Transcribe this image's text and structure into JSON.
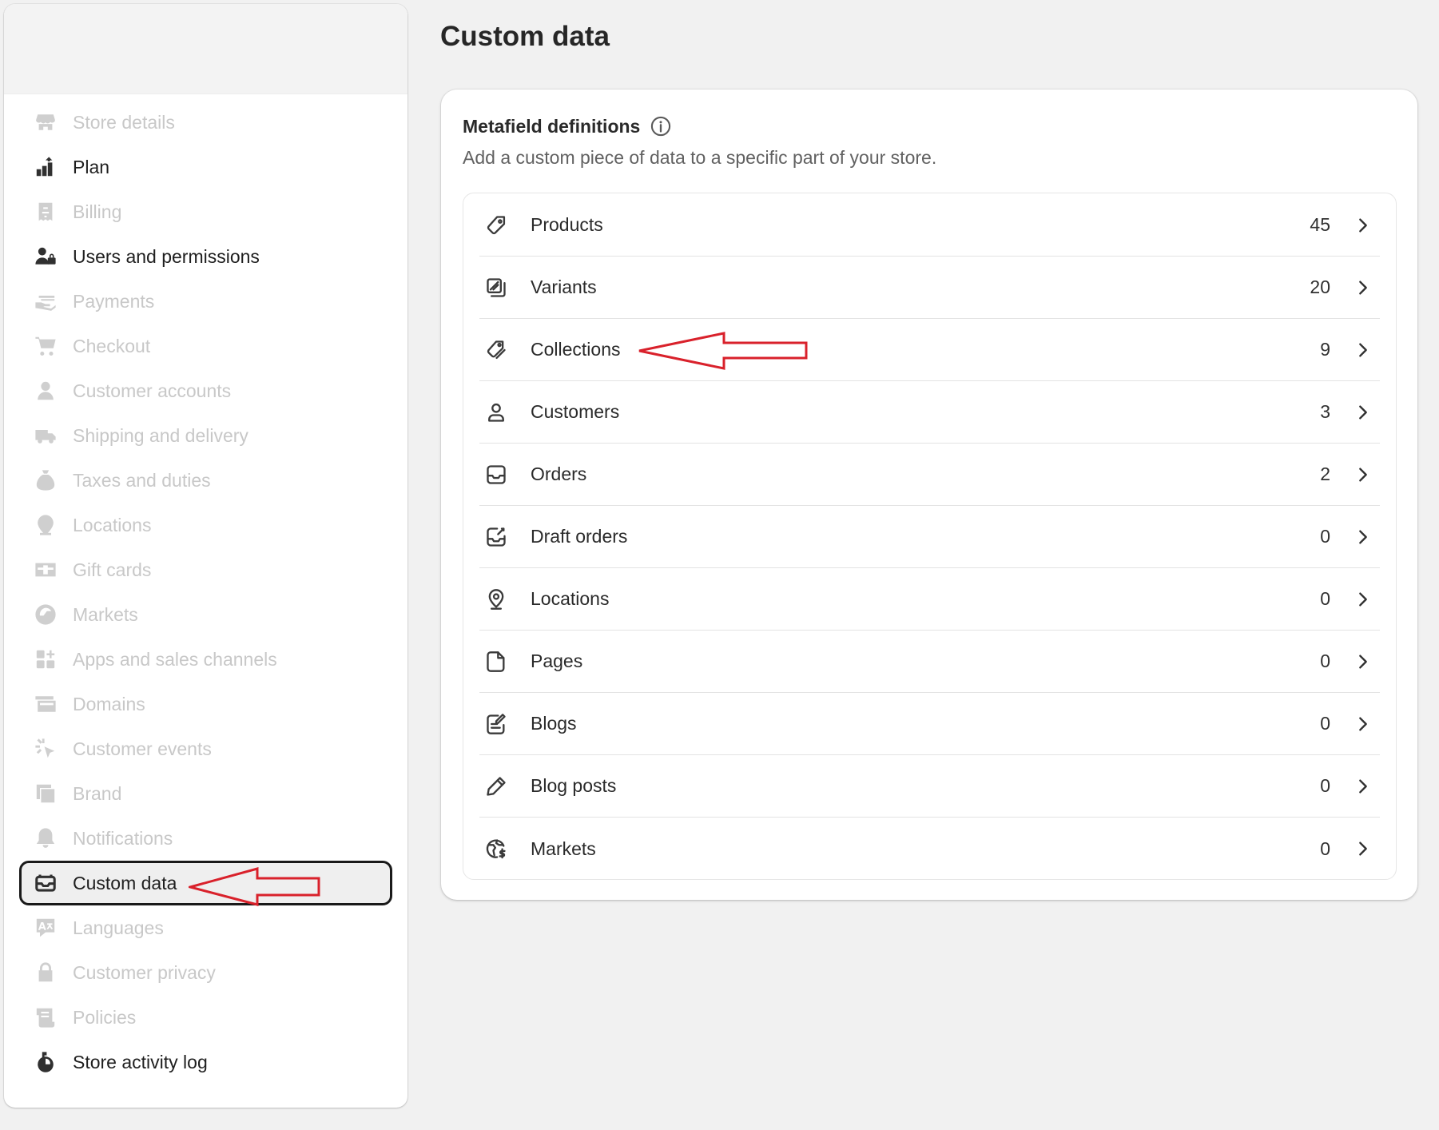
{
  "sidebar": {
    "items": [
      {
        "label": "Store details",
        "icon": "store-icon",
        "state": "disabled"
      },
      {
        "label": "Plan",
        "icon": "plan-icon",
        "state": "enabled"
      },
      {
        "label": "Billing",
        "icon": "receipt-icon",
        "state": "disabled"
      },
      {
        "label": "Users and permissions",
        "icon": "users-icon",
        "state": "enabled"
      },
      {
        "label": "Payments",
        "icon": "payment-hand-icon",
        "state": "disabled"
      },
      {
        "label": "Checkout",
        "icon": "cart-icon",
        "state": "disabled"
      },
      {
        "label": "Customer accounts",
        "icon": "person-icon",
        "state": "disabled"
      },
      {
        "label": "Shipping and delivery",
        "icon": "truck-icon",
        "state": "disabled"
      },
      {
        "label": "Taxes and duties",
        "icon": "tax-bag-icon",
        "state": "disabled"
      },
      {
        "label": "Locations",
        "icon": "location-pin-icon",
        "state": "disabled"
      },
      {
        "label": "Gift cards",
        "icon": "gift-card-icon",
        "state": "disabled"
      },
      {
        "label": "Markets",
        "icon": "globe-icon",
        "state": "disabled"
      },
      {
        "label": "Apps and sales channels",
        "icon": "apps-icon",
        "state": "disabled"
      },
      {
        "label": "Domains",
        "icon": "domains-icon",
        "state": "disabled"
      },
      {
        "label": "Customer events",
        "icon": "cursor-click-icon",
        "state": "disabled"
      },
      {
        "label": "Brand",
        "icon": "brand-icon",
        "state": "disabled"
      },
      {
        "label": "Notifications",
        "icon": "bell-icon",
        "state": "disabled"
      },
      {
        "label": "Custom data",
        "icon": "custom-data-icon",
        "state": "selected"
      },
      {
        "label": "Languages",
        "icon": "translate-icon",
        "state": "disabled"
      },
      {
        "label": "Customer privacy",
        "icon": "lock-icon",
        "state": "disabled"
      },
      {
        "label": "Policies",
        "icon": "policy-scroll-icon",
        "state": "disabled"
      },
      {
        "label": "Store activity log",
        "icon": "activity-log-icon",
        "state": "enabled"
      }
    ]
  },
  "main": {
    "title": "Custom data",
    "card": {
      "title": "Metafield definitions",
      "subtitle": "Add a custom piece of data to a specific part of your store.",
      "rows": [
        {
          "label": "Products",
          "count": "45",
          "icon": "tag-icon"
        },
        {
          "label": "Variants",
          "count": "20",
          "icon": "variants-icon"
        },
        {
          "label": "Collections",
          "count": "9",
          "icon": "collection-tag-icon"
        },
        {
          "label": "Customers",
          "count": "3",
          "icon": "person-outline-icon"
        },
        {
          "label": "Orders",
          "count": "2",
          "icon": "inbox-icon"
        },
        {
          "label": "Draft orders",
          "count": "0",
          "icon": "draft-order-icon"
        },
        {
          "label": "Locations",
          "count": "0",
          "icon": "location-outline-icon"
        },
        {
          "label": "Pages",
          "count": "0",
          "icon": "page-icon"
        },
        {
          "label": "Blogs",
          "count": "0",
          "icon": "blog-icon"
        },
        {
          "label": "Blog posts",
          "count": "0",
          "icon": "pencil-icon"
        },
        {
          "label": "Markets",
          "count": "0",
          "icon": "globe-outline-icon"
        }
      ]
    }
  },
  "colors": {
    "annotation_arrow": "#d9212b",
    "selected_border": "#1a1a1a",
    "disabled_text": "#c8c8c8"
  }
}
